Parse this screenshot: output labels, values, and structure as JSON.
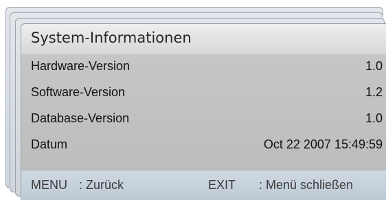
{
  "dialog": {
    "title": "System-Informationen",
    "rows": [
      {
        "label": "Hardware-Version",
        "value": "1.0"
      },
      {
        "label": "Software-Version",
        "value": "1.2"
      },
      {
        "label": "Database-Version",
        "value": "1.0"
      },
      {
        "label": "Datum",
        "value": "Oct 22 2007 15:49:59"
      }
    ],
    "footer": {
      "back_key": "MENU",
      "back_label": ": Zurück",
      "exit_key": "EXIT",
      "exit_label": ": Menü schließen"
    }
  }
}
